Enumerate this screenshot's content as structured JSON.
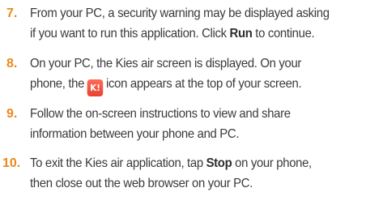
{
  "steps": [
    {
      "number": "7.",
      "line1_before": "From your PC, a security warning may be displayed asking",
      "line2_before": "if you want to run this application. Click ",
      "line2_bold": "Run",
      "line2_after": " to continue."
    },
    {
      "number": "8.",
      "line1_before": "On your PC, the Kies air screen is displayed. On your",
      "line2_before": "phone, the",
      "icon_name": "kies-air-icon",
      "icon_text": "K!",
      "line2_after": "icon appears at the top of your screen."
    },
    {
      "number": "9.",
      "line1_before": "Follow the on-screen instructions to view and share",
      "line2_before": "information between your phone and PC."
    },
    {
      "number": "10.",
      "line1_before": "To exit the Kies air application, tap ",
      "line1_bold": "Stop",
      "line1_after": " on your phone,",
      "line2_before": "then close out the web browser on your PC."
    }
  ],
  "colors": {
    "number": "#e8891c",
    "text": "#3a3a3a",
    "icon_background": "#e8412f"
  }
}
